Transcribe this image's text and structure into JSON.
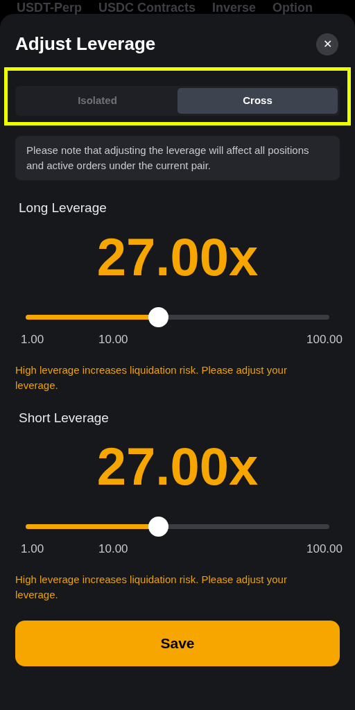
{
  "background_tabs": [
    "USDT-Perp",
    "USDC Contracts",
    "Inverse",
    "Option"
  ],
  "dialog": {
    "title": "Adjust Leverage",
    "close": "✕"
  },
  "margin_modes": [
    {
      "label": "Isolated",
      "selected": false
    },
    {
      "label": "Cross",
      "selected": true
    }
  ],
  "notice": "Please note that adjusting the leverage will affect all positions and active orders under the current pair.",
  "leverages": [
    {
      "label": "Long Leverage",
      "value": "27.00x",
      "level": 0.435,
      "ticks": [
        "1.00",
        "10.00",
        "100.00"
      ],
      "warning": "High leverage increases liquidation risk. Please adjust your leverage."
    },
    {
      "label": "Short Leverage",
      "value": "27.00x",
      "level": 0.435,
      "ticks": [
        "1.00",
        "10.00",
        "100.00"
      ],
      "warning": "High leverage increases liquidation risk. Please adjust your leverage."
    }
  ],
  "save_button": "Save"
}
